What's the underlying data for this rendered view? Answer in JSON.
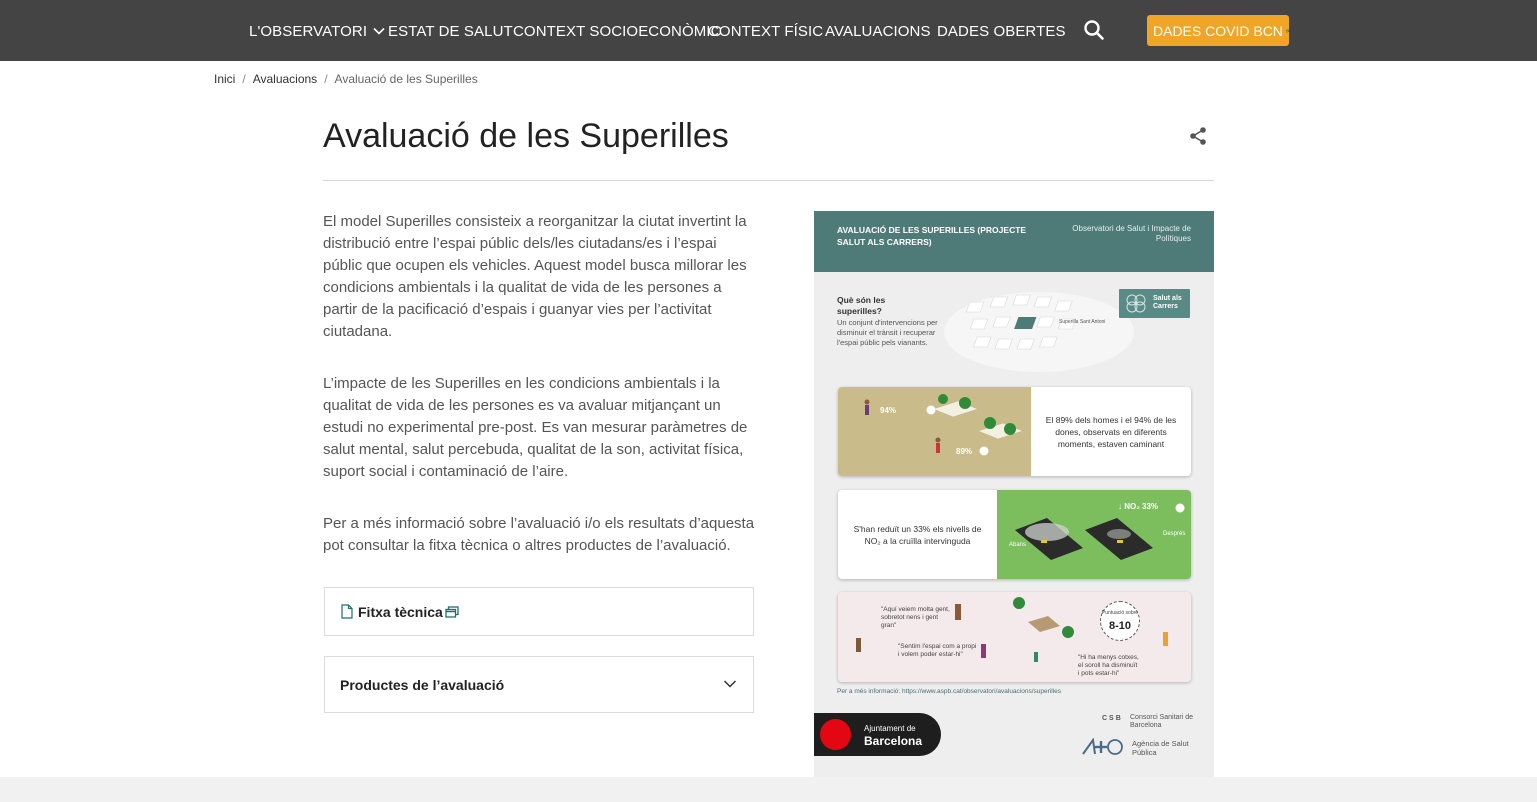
{
  "nav": {
    "items": [
      {
        "label": "L'OBSERVATORI",
        "has_dropdown": true
      },
      {
        "label": "ESTAT DE SALUT"
      },
      {
        "label": "CONTEXT SOCIOECONÒMIC"
      },
      {
        "label": "CONTEXT FÍSIC"
      },
      {
        "label": "AVALUACIONS"
      },
      {
        "label": "DADES OBERTES"
      }
    ],
    "search_icon": "search-icon",
    "covid_button": "DADES COVID BCN",
    "colors": {
      "bar": "#444444",
      "covid": "#f0a527"
    }
  },
  "breadcrumb": {
    "home": "Inici",
    "parent": "Avaluacions",
    "current": "Avaluació de les Superilles",
    "sep": "/"
  },
  "page": {
    "title": "Avaluació de les Superilles",
    "share_icon": "share-icon",
    "paragraphs": [
      "El model Superilles consisteix a reorganitzar la ciutat invertint la distribució entre l’espai públic dels/les ciutadans/es i l’espai públic que ocupen els vehicles. Aquest model busca millorar les condicions ambientals i la qualitat de vida de les persones a partir de la pacificació d’espais i guanyar vies per l’activitat ciutadana.",
      "L’impacte de les Superilles en les condicions ambientals i la qualitat de vida de les persones es va avaluar mitjançant un estudi no experimental pre-post. Es van mesurar paràmetres de salut mental, salut percebuda, qualitat de la son, activitat física, suport social i contaminació de l’aire.",
      "Per a més informació sobre l’avaluació i/o els resultats d’aquesta pot consultar la fitxa tècnica o altres productes de l’avaluació."
    ],
    "fitxa_label": "Fitxa tècnica",
    "productes_label": "Productes de l’avaluació"
  },
  "infographic": {
    "header_title": "AVALUACIÓ DE LES SUPERILLES (PROJECTE SALUT ALS CARRERS)",
    "header_org": "Observatori de Salut i Impacte de Polítiques",
    "question": "Què són les superilles?",
    "question_desc": "Un conjunt d'intervencions per disminuir el trànsit i recuperar l'espai públic pels vianants.",
    "badge": "Salut als Carrers",
    "map_label": "Superilla Sant Antoni",
    "card1_pct_a": "94%",
    "card1_pct_b": "89%",
    "card1_text": "El 89% dels homes i el 94% de les dones, observats en diferents moments, estaven caminant",
    "card2_text": "S'han reduït un 33% els nivells de NO₂ a la cruïlla intervinguda",
    "card2_pct": "↓ NO₂ 33%",
    "card2_before": "Abans",
    "card2_after": "Després",
    "card3_quotes": [
      "\"Aquí veiem molta gent, sobretot nens i gent gran\"",
      "\"Sentim l'espai com a propi i volem poder estar-hi\"",
      "\"Hi ha menys cotxes, el soroll ha disminuït i pots estar-hi\""
    ],
    "card3_score_label": "Puntuació sobre",
    "card3_score": "8-10",
    "more_info": "Per a més informació: https://www.aspb.cat/observatori/avaluacions/superilles",
    "ajb_line1": "Ajuntament de",
    "ajb_line2": "Barcelona",
    "csb_abbr": "CSB",
    "csb_name": "Consorci Sanitari de Barcelona",
    "aspb_name": "Agència de Salut Pública"
  }
}
